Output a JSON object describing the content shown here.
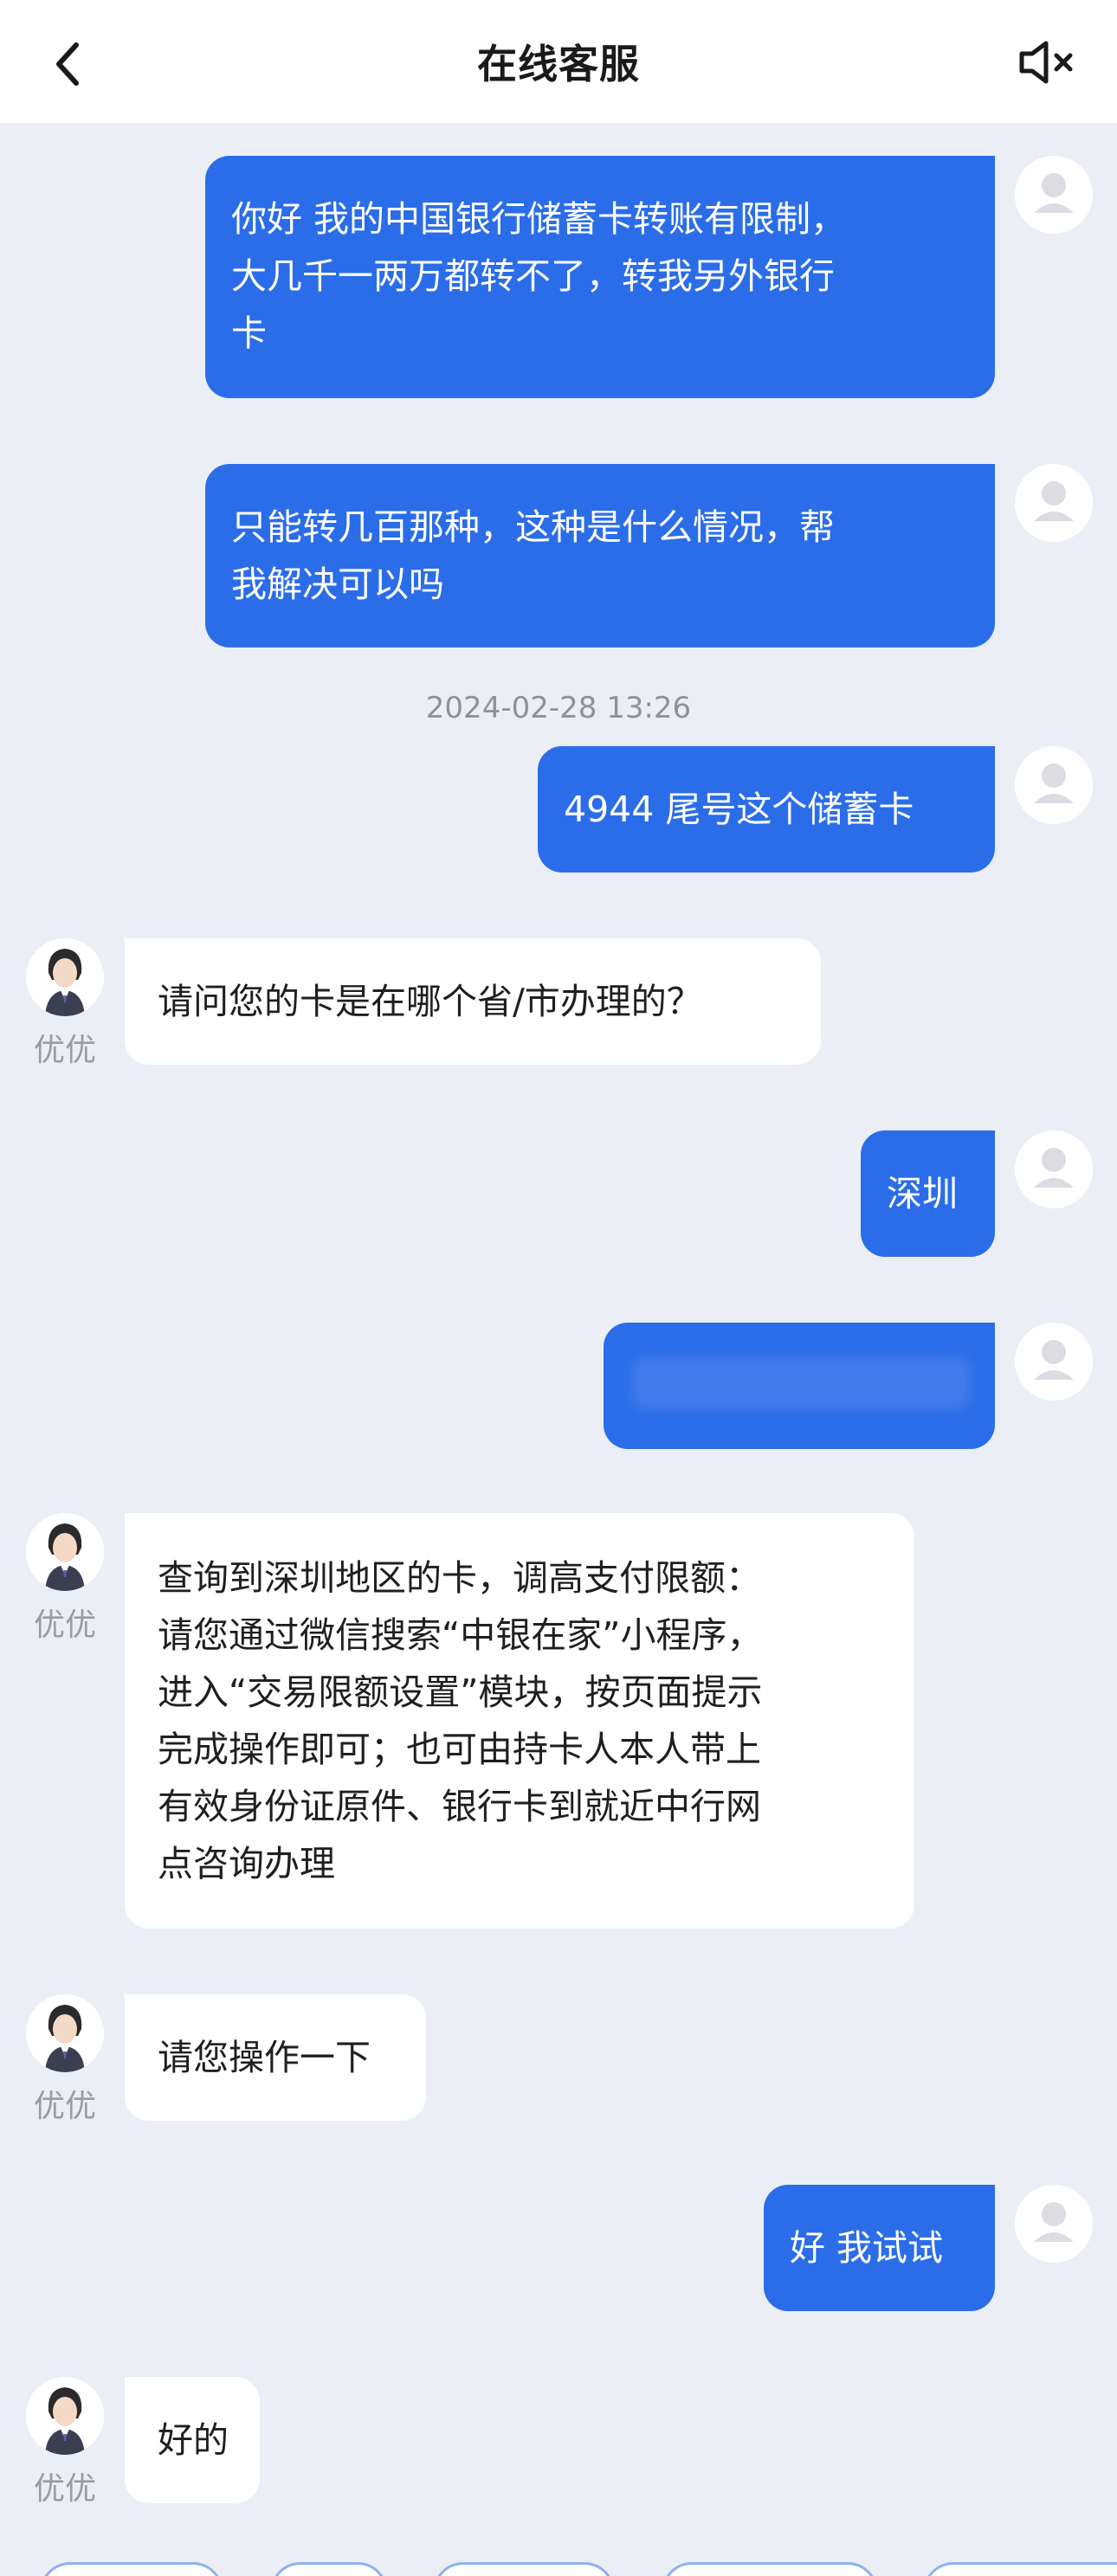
{
  "header": {
    "title": "在线客服",
    "back_icon": "chevron-left-icon",
    "mute_icon": "speaker-muted-icon"
  },
  "colors": {
    "user_bubble": "#2b6de8",
    "agent_bubble": "#ffffff",
    "background": "#eceef6"
  },
  "messages": {
    "m1": {
      "sender": "user",
      "text": "你好 我的中国银行储蓄卡转账有限制，\n大几千一两万都转不了，转我另外银行\n卡"
    },
    "m2": {
      "sender": "user",
      "text": "只能转几百那种，这种是什么情况，帮\n我解决可以吗"
    },
    "timestamp": "2024-02-28 13:26",
    "m3": {
      "sender": "user",
      "text": "4944 尾号这个储蓄卡"
    },
    "m4": {
      "sender": "agent",
      "name": "优优",
      "text": "请问您的卡是在哪个省/市办理的？"
    },
    "m5": {
      "sender": "user",
      "text": "深圳"
    },
    "m6": {
      "sender": "user",
      "text": ""
    },
    "m7": {
      "sender": "agent",
      "name": "优优",
      "text": "查询到深圳地区的卡，调高支付限额：\n请您通过微信搜索“中银在家”小程序，\n进入“交易限额设置”模块，按页面提示\n完成操作即可；也可由持卡人本人带上\n有效身份证原件、银行卡到就近中行网\n点咨询办理"
    },
    "m8": {
      "sender": "agent",
      "name": "优优",
      "text": "请您操作一下"
    },
    "m9": {
      "sender": "user",
      "text": "好 我试试"
    },
    "m10": {
      "sender": "agent",
      "name": "优优",
      "text": "好的"
    }
  }
}
